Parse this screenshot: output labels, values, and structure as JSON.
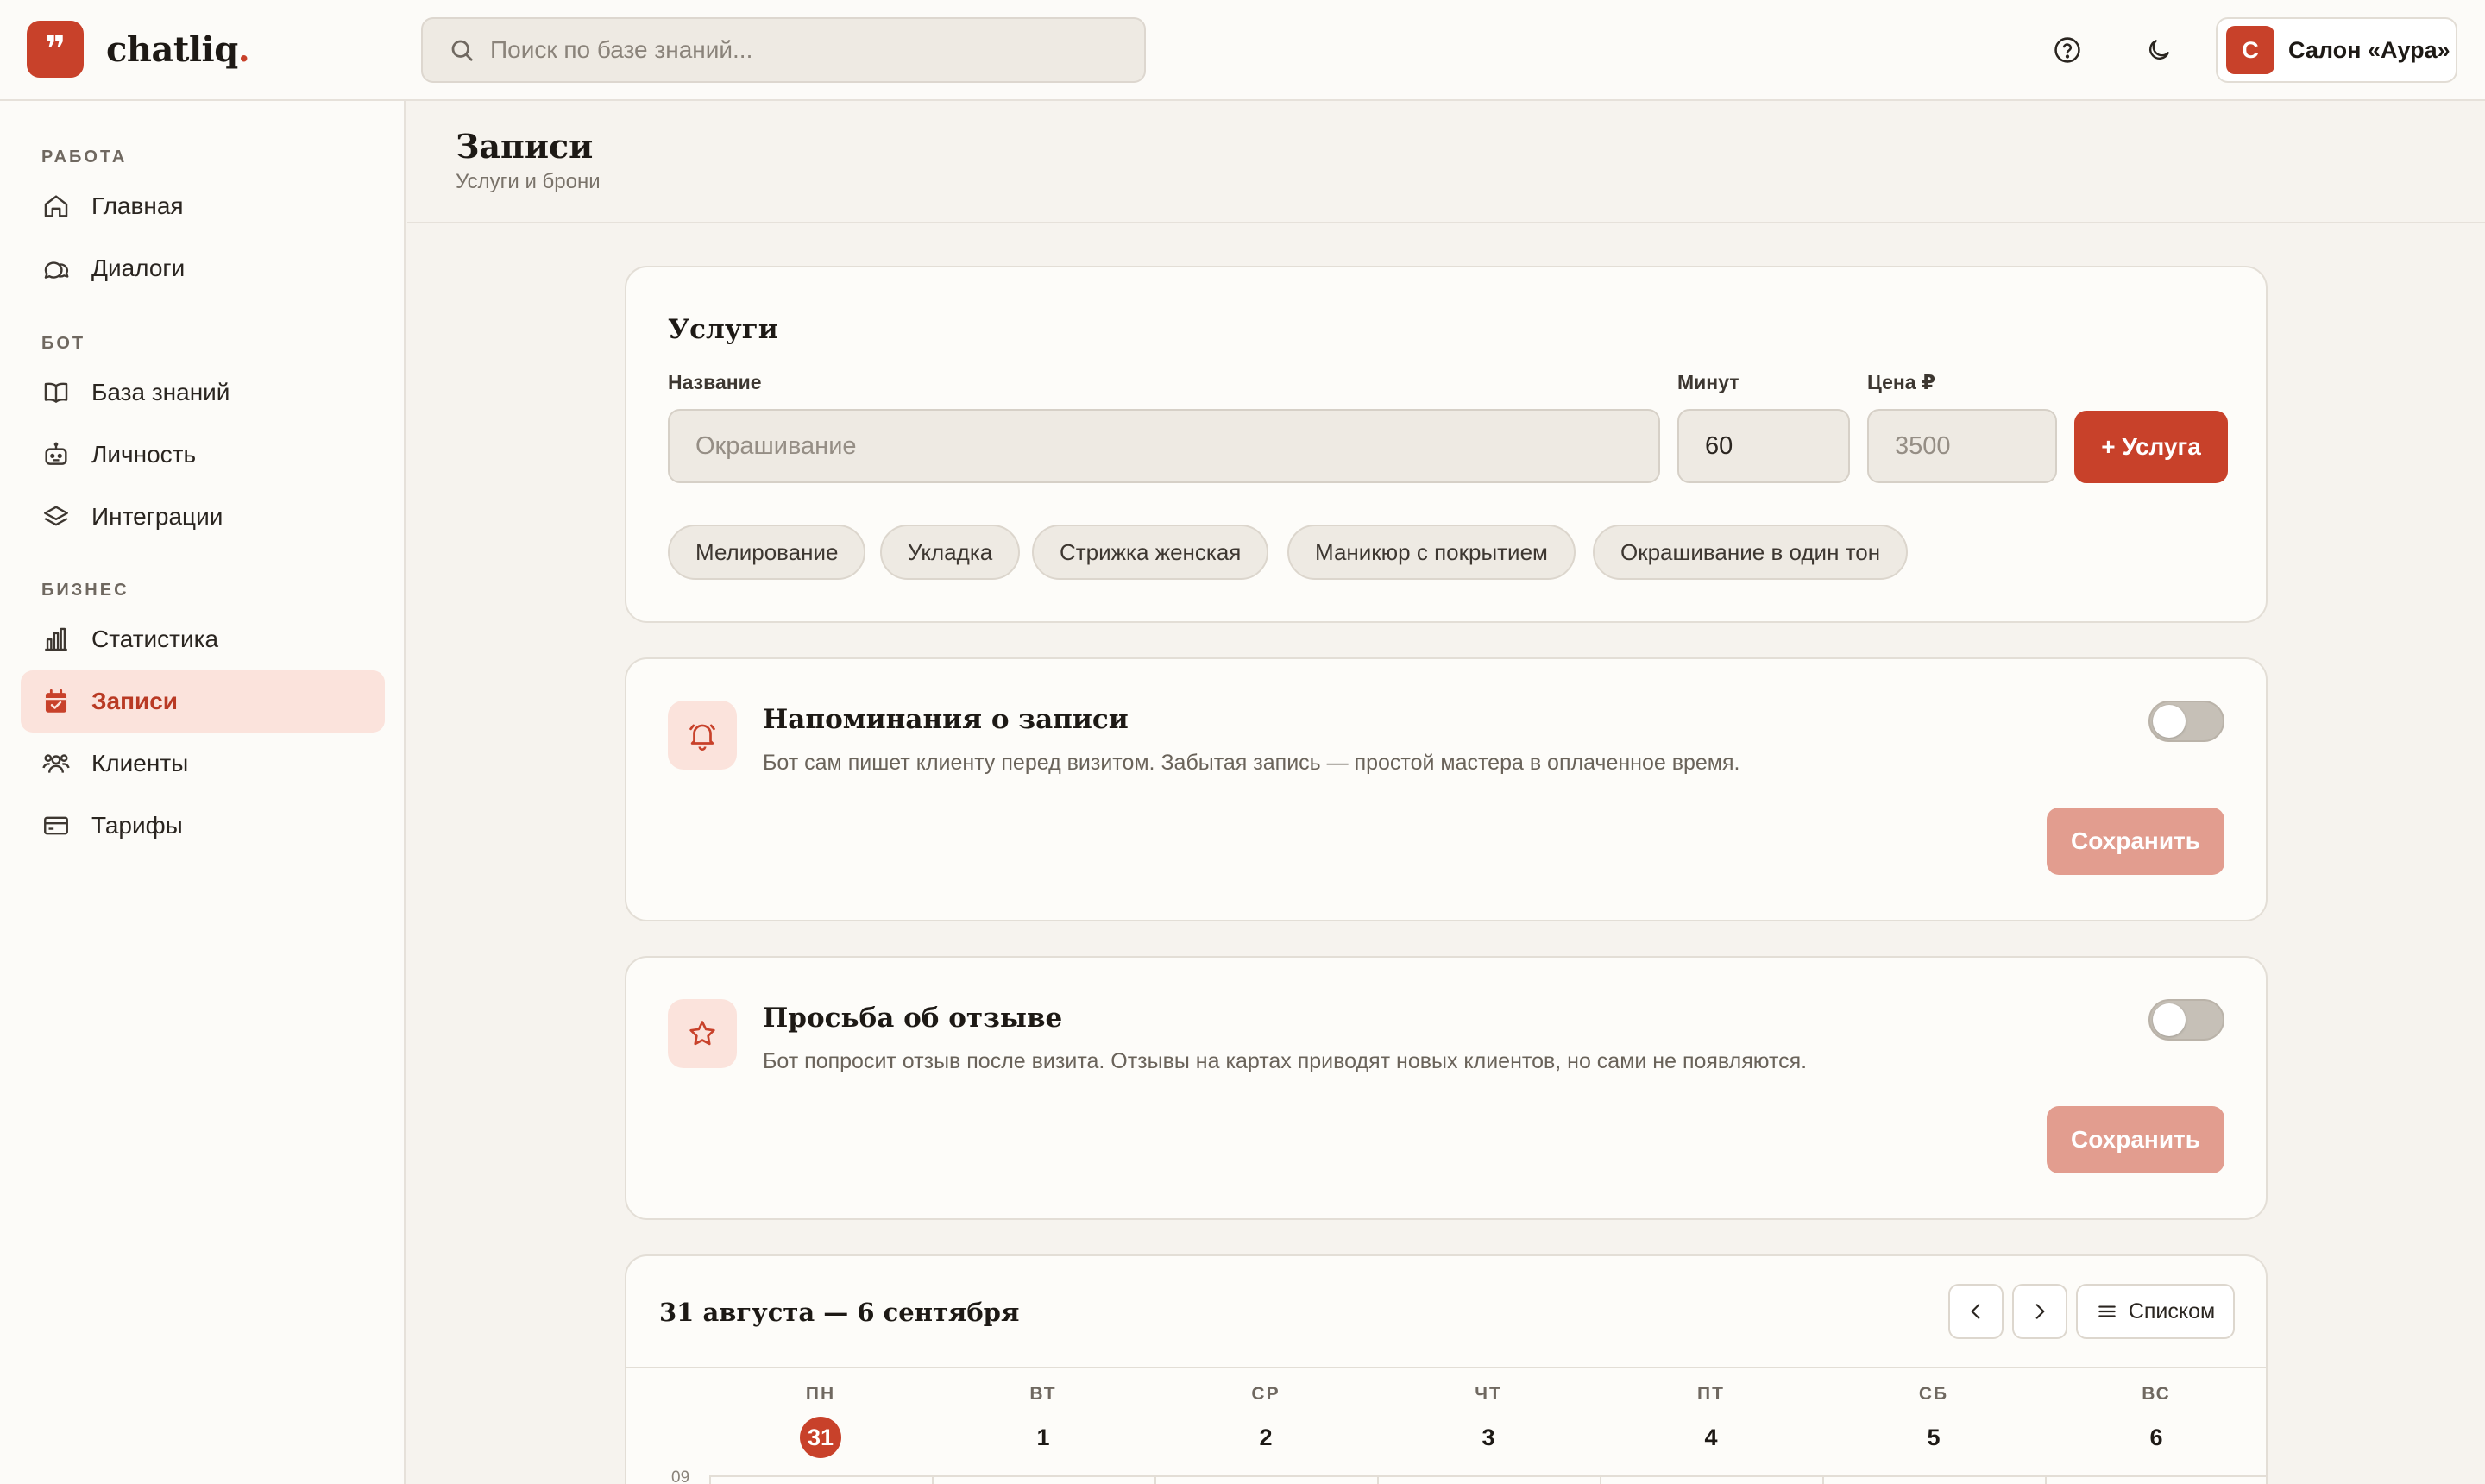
{
  "app": {
    "logo_glyph": "❞",
    "name": "chatliq",
    "name_dot": ".",
    "accent": "#c8412a"
  },
  "search": {
    "placeholder": "Поиск по базе знаний..."
  },
  "header": {
    "help_icon": "help-circle-icon",
    "theme_icon": "moon-icon",
    "account": {
      "avatar_letter": "С",
      "name": "Салон «Аура»"
    }
  },
  "sidebar": {
    "sections": [
      {
        "title": "РАБОТА"
      },
      {
        "title": "БОТ"
      },
      {
        "title": "БИЗНЕС"
      }
    ],
    "items": [
      {
        "label": "Главная",
        "icon": "home-icon"
      },
      {
        "label": "Диалоги",
        "icon": "chat-icon"
      },
      {
        "label": "База знаний",
        "icon": "book-icon"
      },
      {
        "label": "Личность",
        "icon": "bot-icon"
      },
      {
        "label": "Интеграции",
        "icon": "layers-icon"
      },
      {
        "label": "Статистика",
        "icon": "bar-chart-icon"
      },
      {
        "label": "Записи",
        "icon": "calendar-icon",
        "active": true
      },
      {
        "label": "Клиенты",
        "icon": "users-icon"
      },
      {
        "label": "Тарифы",
        "icon": "card-icon"
      }
    ]
  },
  "page": {
    "title": "Записи",
    "subtitle": "Услуги и брони"
  },
  "services": {
    "title": "Услуги",
    "name_label": "Название",
    "name_placeholder": "Окрашивание",
    "minutes_label": "Минут",
    "minutes_value": "60",
    "price_label": "Цена ₽",
    "price_placeholder": "3500",
    "add_button": "+ Услуга",
    "chips": [
      "Мелирование",
      "Укладка",
      "Стрижка женская",
      "Маникюр с покрытием",
      "Окрашивание в один тон"
    ]
  },
  "reminders": {
    "title": "Напоминания о записи",
    "description": "Бот сам пишет клиенту перед визитом. Забытая запись — простой мастера в оплаченное время.",
    "enabled": false,
    "save_button": "Сохранить",
    "icon": "bell-icon"
  },
  "review_request": {
    "title": "Просьба об отзыве",
    "description": "Бот попросит отзыв после визита. Отзывы на картах приводят новых клиентов, но сами не появляются.",
    "enabled": false,
    "save_button": "Сохранить",
    "icon": "star-icon"
  },
  "calendar": {
    "range": "31 августа — 6 сентября",
    "list_button": "Списком",
    "days": [
      {
        "name": "ПН",
        "num": "31",
        "today": true
      },
      {
        "name": "ВТ",
        "num": "1"
      },
      {
        "name": "СР",
        "num": "2"
      },
      {
        "name": "ЧТ",
        "num": "3"
      },
      {
        "name": "ПТ",
        "num": "4"
      },
      {
        "name": "СБ",
        "num": "5"
      },
      {
        "name": "ВС",
        "num": "6"
      }
    ],
    "first_hour": "09"
  }
}
